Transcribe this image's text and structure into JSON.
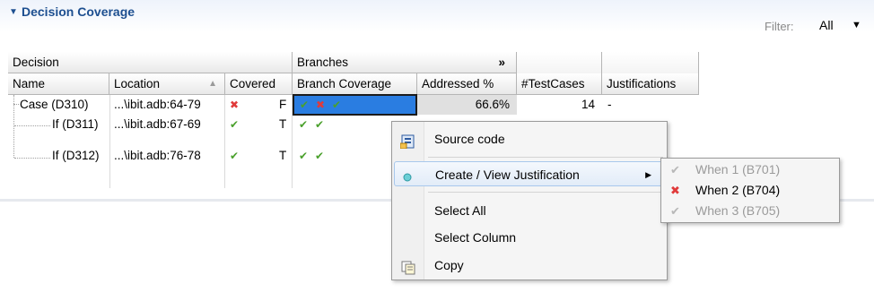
{
  "section": {
    "title": "Decision Coverage",
    "filter_label": "Filter:",
    "filter_value": "All"
  },
  "table": {
    "groups": {
      "decision": "Decision",
      "branches": "Branches",
      "expand": "»"
    },
    "columns": {
      "name": "Name",
      "location": "Location",
      "covered": "Covered",
      "branch_coverage": "Branch Coverage",
      "addressed": "Addressed %",
      "testcases": "#TestCases",
      "justifications": "Justifications"
    },
    "rows": [
      {
        "name": "Case (D310)",
        "location": "...\\ibit.adb:64-79",
        "covered_mark": "✖",
        "covered": "F",
        "branches": [
          "✔",
          "✖",
          "✔"
        ],
        "addressed": "66.6%",
        "testcases": "14",
        "justifications": "-"
      },
      {
        "name": "If (D311)",
        "location": "...\\ibit.adb:67-69",
        "covered_mark": "✔",
        "covered": "T",
        "branches": [
          "✔",
          "✔"
        ]
      },
      {
        "name": "If (D312)",
        "location": "...\\ibit.adb:76-78",
        "covered_mark": "✔",
        "covered": "T",
        "branches": [
          "✔",
          "✔"
        ]
      }
    ]
  },
  "context_menu": {
    "source_code": "Source code",
    "create_view": "Create / View Justification",
    "select_all": "Select All",
    "select_column": "Select Column",
    "copy": "Copy",
    "submenu": [
      {
        "label": "When 1 (B701)",
        "mark": "✔",
        "state": "disabled"
      },
      {
        "label": "When 2 (B704)",
        "mark": "✖",
        "state": "enabled"
      },
      {
        "label": "When 3 (B705)",
        "mark": "✔",
        "state": "disabled"
      }
    ]
  },
  "colors": {
    "title": "#1d4f90",
    "check": "#4aa02c",
    "cross": "#e03a3a",
    "selection": "#2a7de1"
  }
}
